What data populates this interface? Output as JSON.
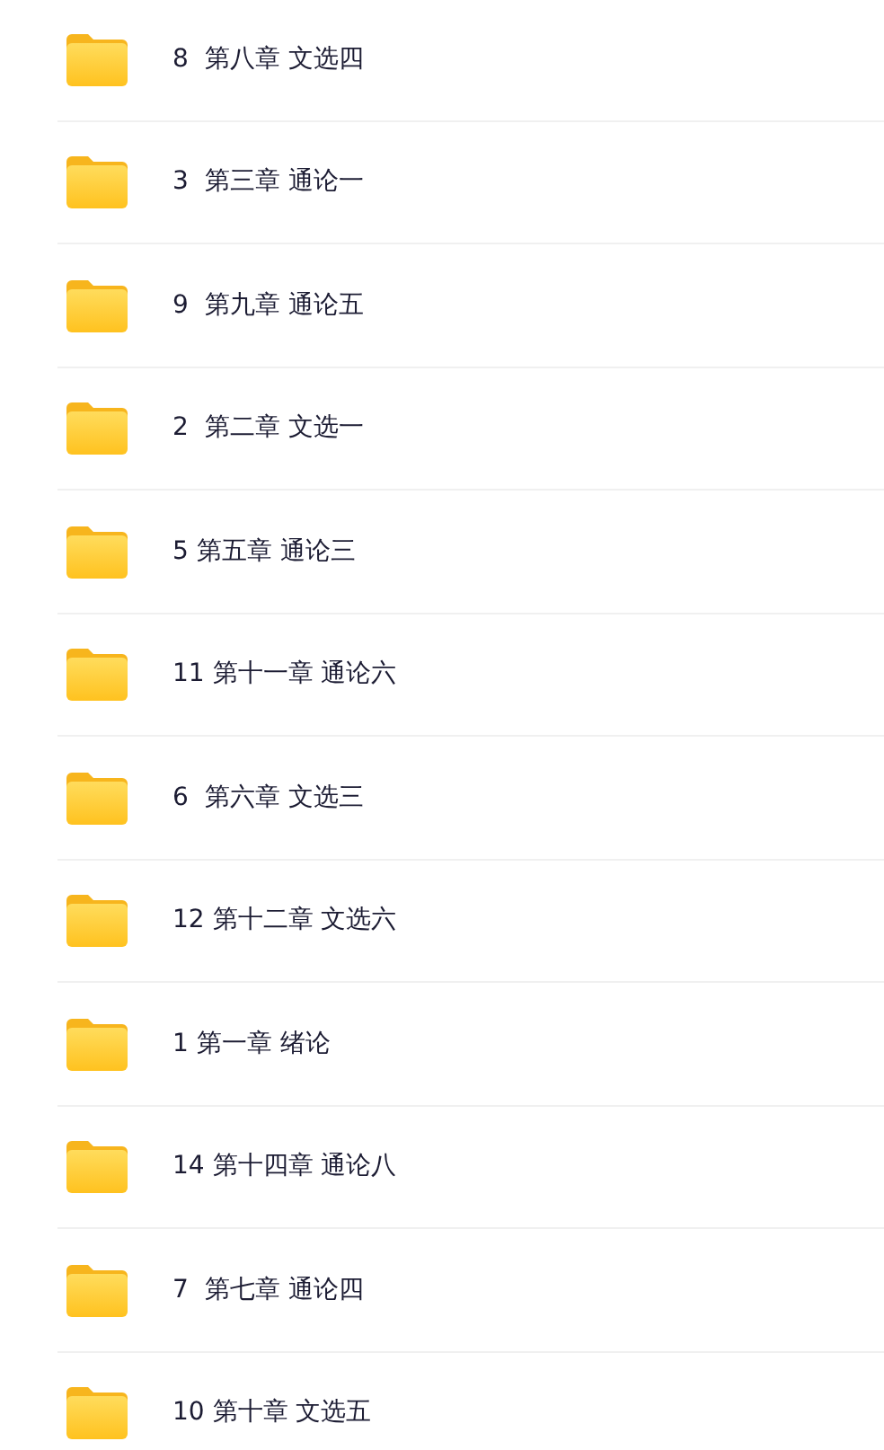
{
  "folders": [
    {
      "name": "8  第八章 文选四"
    },
    {
      "name": "3  第三章 通论一"
    },
    {
      "name": "9  第九章 通论五"
    },
    {
      "name": "2  第二章 文选一"
    },
    {
      "name": "5 第五章 通论三"
    },
    {
      "name": "11 第十一章 通论六"
    },
    {
      "name": "6  第六章 文选三"
    },
    {
      "name": "12 第十二章 文选六"
    },
    {
      "name": "1 第一章 绪论"
    },
    {
      "name": "14 第十四章 通论八"
    },
    {
      "name": "7  第七章 通论四"
    },
    {
      "name": "10 第十章 文选五"
    }
  ]
}
